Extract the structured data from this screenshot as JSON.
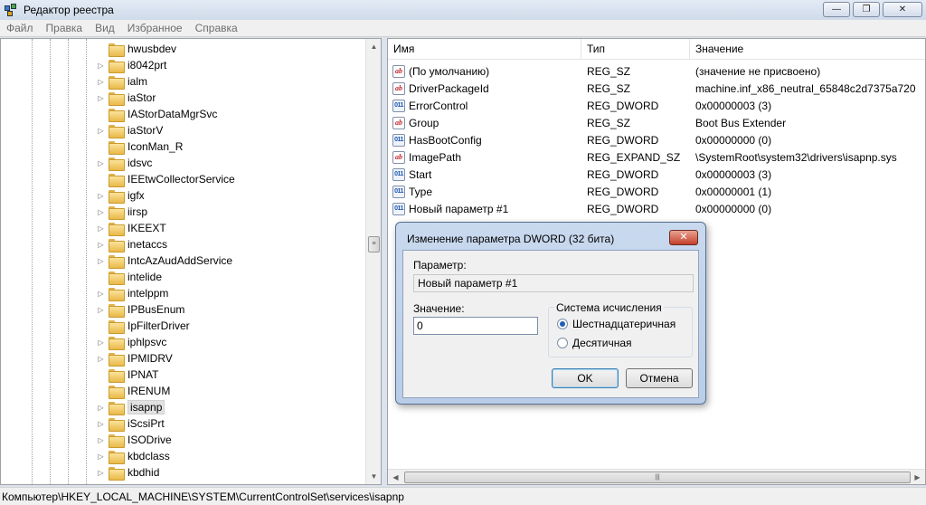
{
  "window": {
    "title": "Редактор реестра",
    "minimize_glyph": "—",
    "maximize_glyph": "❐",
    "close_glyph": "✕"
  },
  "menu": [
    "Файл",
    "Правка",
    "Вид",
    "Избранное",
    "Справка"
  ],
  "tree": {
    "selected": "isapnp",
    "items": [
      {
        "label": "hwusbdev",
        "expandable": false
      },
      {
        "label": "i8042prt",
        "expandable": true
      },
      {
        "label": "ialm",
        "expandable": true
      },
      {
        "label": "iaStor",
        "expandable": true
      },
      {
        "label": "IAStorDataMgrSvc",
        "expandable": false
      },
      {
        "label": "iaStorV",
        "expandable": true
      },
      {
        "label": "IconMan_R",
        "expandable": false
      },
      {
        "label": "idsvc",
        "expandable": true
      },
      {
        "label": "IEEtwCollectorService",
        "expandable": false
      },
      {
        "label": "igfx",
        "expandable": true
      },
      {
        "label": "iirsp",
        "expandable": true
      },
      {
        "label": "IKEEXT",
        "expandable": true
      },
      {
        "label": "inetaccs",
        "expandable": true
      },
      {
        "label": "IntcAzAudAddService",
        "expandable": true
      },
      {
        "label": "intelide",
        "expandable": false
      },
      {
        "label": "intelppm",
        "expandable": true
      },
      {
        "label": "IPBusEnum",
        "expandable": true
      },
      {
        "label": "IpFilterDriver",
        "expandable": false
      },
      {
        "label": "iphlpsvc",
        "expandable": true
      },
      {
        "label": "IPMIDRV",
        "expandable": true
      },
      {
        "label": "IPNAT",
        "expandable": false
      },
      {
        "label": "IRENUM",
        "expandable": false
      },
      {
        "label": "isapnp",
        "expandable": true
      },
      {
        "label": "iScsiPrt",
        "expandable": true
      },
      {
        "label": "ISODrive",
        "expandable": true
      },
      {
        "label": "kbdclass",
        "expandable": true
      },
      {
        "label": "kbdhid",
        "expandable": true
      }
    ]
  },
  "values_table": {
    "columns": [
      "Имя",
      "Тип",
      "Значение"
    ],
    "rows": [
      {
        "kind": "sz",
        "name": "(По умолчанию)",
        "type": "REG_SZ",
        "data": "(значение не присвоено)"
      },
      {
        "kind": "sz",
        "name": "DriverPackageId",
        "type": "REG_SZ",
        "data": "machine.inf_x86_neutral_65848c2d7375a720"
      },
      {
        "kind": "dw",
        "name": "ErrorControl",
        "type": "REG_DWORD",
        "data": "0x00000003 (3)"
      },
      {
        "kind": "sz",
        "name": "Group",
        "type": "REG_SZ",
        "data": "Boot Bus Extender"
      },
      {
        "kind": "dw",
        "name": "HasBootConfig",
        "type": "REG_DWORD",
        "data": "0x00000000 (0)"
      },
      {
        "kind": "sz",
        "name": "ImagePath",
        "type": "REG_EXPAND_SZ",
        "data": "\\SystemRoot\\system32\\drivers\\isapnp.sys"
      },
      {
        "kind": "dw",
        "name": "Start",
        "type": "REG_DWORD",
        "data": "0x00000003 (3)"
      },
      {
        "kind": "dw",
        "name": "Type",
        "type": "REG_DWORD",
        "data": "0x00000001 (1)"
      },
      {
        "kind": "dw",
        "name": "Новый параметр #1",
        "type": "REG_DWORD",
        "data": "0x00000000 (0)"
      }
    ]
  },
  "icons": {
    "sz": "ab",
    "dw": "011"
  },
  "status_path": "Компьютер\\HKEY_LOCAL_MACHINE\\SYSTEM\\CurrentControlSet\\services\\isapnp",
  "dialog": {
    "title": "Изменение параметра DWORD (32 бита)",
    "close_glyph": "✕",
    "param_label": "Параметр:",
    "param_value": "Новый параметр #1",
    "value_label": "Значение:",
    "value": "0",
    "radix_label": "Система исчисления",
    "radix_options": [
      "Шестнадцатеричная",
      "Десятичная"
    ],
    "radix_selected": 0,
    "ok_label": "OK",
    "cancel_label": "Отмена"
  }
}
